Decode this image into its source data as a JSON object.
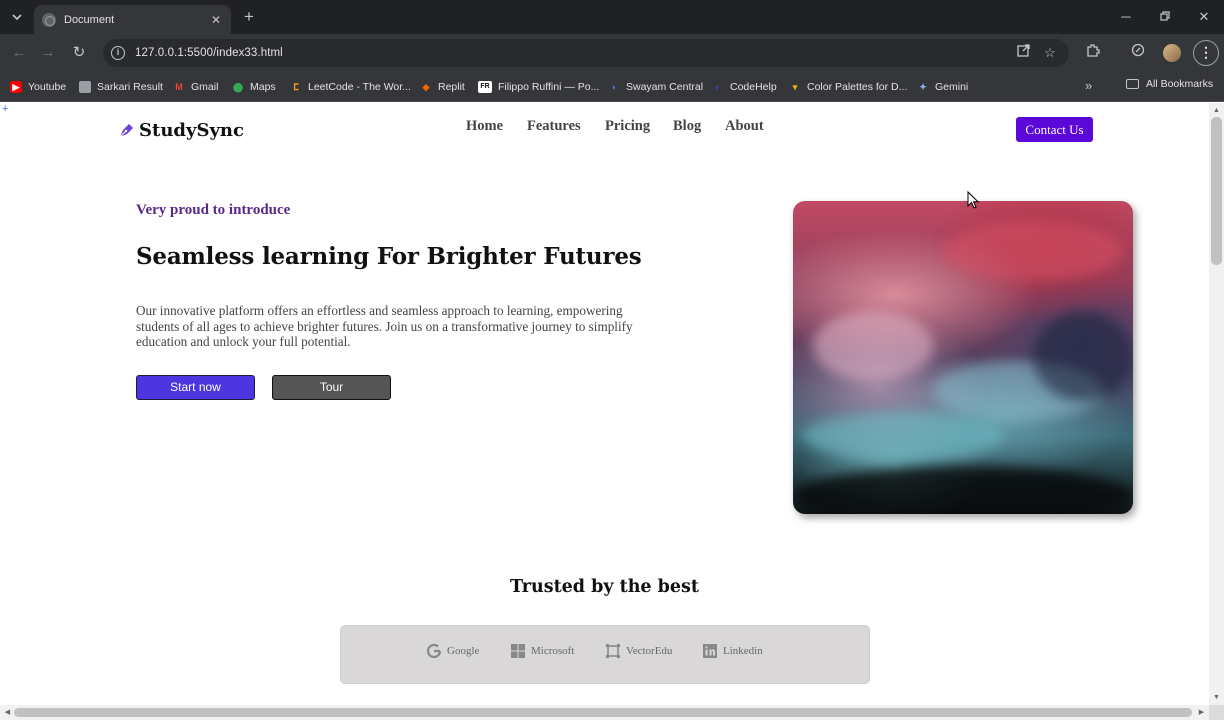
{
  "browser": {
    "tab_title": "Document",
    "url": "127.0.0.1:5500/index33.html",
    "bookmarks": [
      {
        "label": "Youtube",
        "icon": "youtube-icon",
        "color": "#ff0000"
      },
      {
        "label": "Sarkari Result",
        "icon": "sarkari-icon",
        "color": "#9aa0a6"
      },
      {
        "label": "Gmail",
        "icon": "gmail-icon",
        "color": "#ea4335"
      },
      {
        "label": "Maps",
        "icon": "maps-icon",
        "color": "#34a853"
      },
      {
        "label": "LeetCode - The Wor...",
        "icon": "leetcode-icon",
        "color": "#ffa116"
      },
      {
        "label": "Replit",
        "icon": "replit-icon",
        "color": "#f26207"
      },
      {
        "label": "Filippo Ruffini — Po...",
        "icon": "fr-icon",
        "color": "#ffffff"
      },
      {
        "label": "Swayam Central",
        "icon": "swayam-icon",
        "color": "#3b82f6"
      },
      {
        "label": "CodeHelp",
        "icon": "codehelp-icon",
        "color": "#3a2fb0"
      },
      {
        "label": "Color Palettes for D...",
        "icon": "palette-icon",
        "color": "#f4b400"
      },
      {
        "label": "Gemini",
        "icon": "gemini-icon",
        "color": "#8ab4f8"
      }
    ],
    "all_bookmarks": "All Bookmarks"
  },
  "page": {
    "brand": "StudySync",
    "brand_color": "#6b3fd6",
    "nav": [
      "Home",
      "Features",
      "Pricing",
      "Blog",
      "About"
    ],
    "contact_label": "Contact Us",
    "hero": {
      "eyebrow": "Very proud to introduce",
      "title": "Seamless learning For Brighter Futures",
      "description": "Our innovative platform offers an effortless and seamless approach to learning, empowering students of all ages to achieve brighter futures. Join us on a transformative journey to simplify education and unlock your full potential.",
      "start_label": "Start now",
      "tour_label": "Tour"
    },
    "trusted": {
      "title": "Trusted by the best",
      "brands": [
        {
          "label": "Google",
          "icon": "google-icon"
        },
        {
          "label": "Microsoft",
          "icon": "microsoft-icon"
        },
        {
          "label": "VectorEdu",
          "icon": "vectoredu-icon"
        },
        {
          "label": "Linkedin",
          "icon": "linkedin-icon"
        }
      ]
    }
  }
}
